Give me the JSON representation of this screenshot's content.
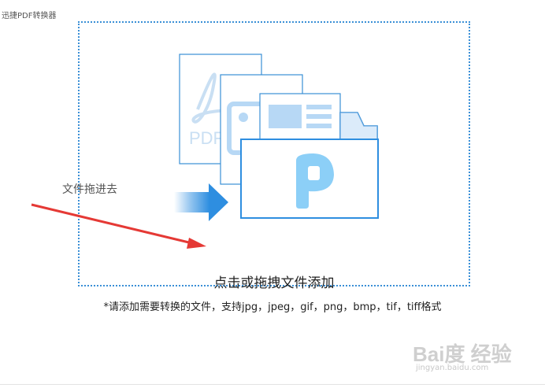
{
  "window": {
    "title": "迅捷PDF转换器"
  },
  "drop_zone": {
    "hint": "点击或拖拽文件添加",
    "side_text": "文件拖进去",
    "doc_label": "PDF"
  },
  "support_note": "*请添加需要转换的文件，支持jpg，jpeg，gif，png，bmp，tif，tiff格式",
  "watermark": {
    "logo": "Bai度 经验",
    "url": "jingyan.baidu.com"
  },
  "colors": {
    "accent": "#2e8ee0",
    "light_blue": "#b7d8f5",
    "arrow_red": "#e53935"
  }
}
